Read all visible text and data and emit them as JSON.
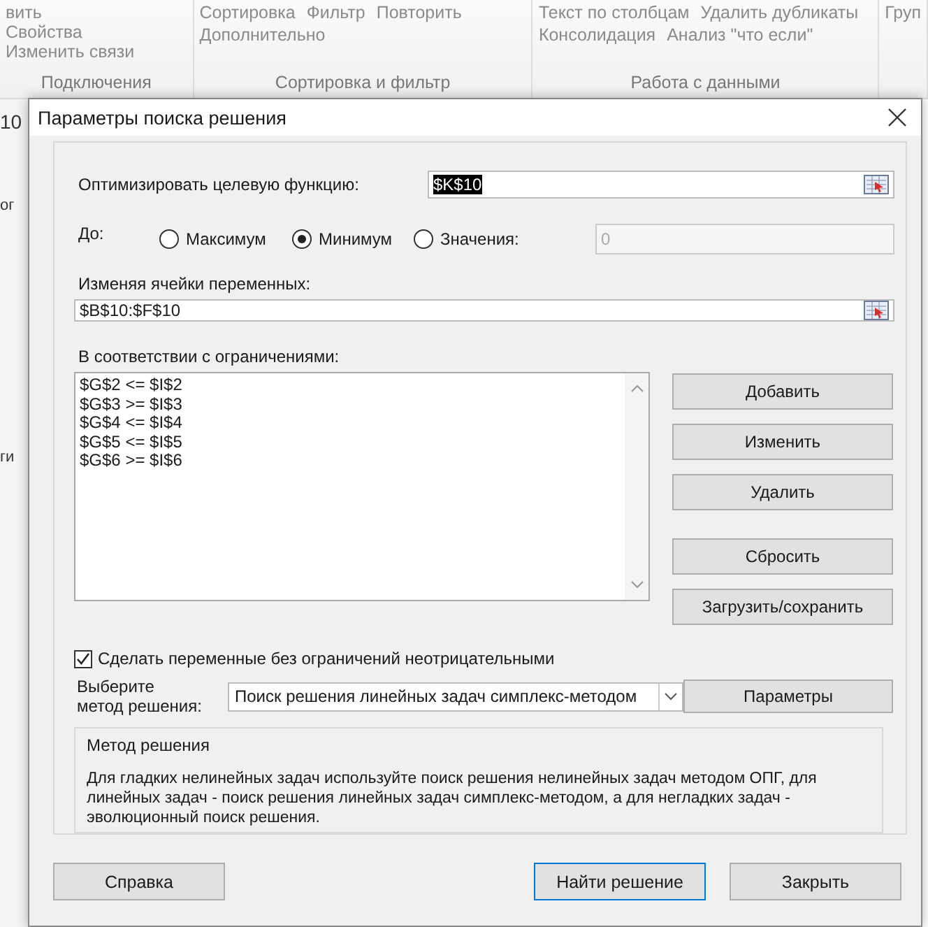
{
  "ribbon": {
    "groups": [
      {
        "label": "Подключения",
        "items": [
          "вить",
          "Свойства",
          "Изменить связи"
        ]
      },
      {
        "label": "Сортировка и фильтр",
        "items": [
          "Сортировка",
          "Фильтр",
          "Повторить",
          "Дополнительно"
        ]
      },
      {
        "label": "Работа с данными",
        "items": [
          "Текст по столбцам",
          "Удалить дубликаты",
          "Консолидация",
          "Анализ \"что если\""
        ]
      },
      {
        "items": [
          "Груп"
        ]
      }
    ]
  },
  "sheet": {
    "cells": [
      "10",
      "ог",
      "ги"
    ]
  },
  "dialog": {
    "title": "Параметры поиска решения",
    "objective": {
      "label": "Оптимизировать целевую функцию:",
      "value": "$K$10"
    },
    "to": {
      "label": "До:",
      "options": [
        {
          "label": "Максимум",
          "selected": false
        },
        {
          "label": "Минимум",
          "selected": true
        },
        {
          "label": "Значения:",
          "selected": false
        }
      ],
      "value": "0",
      "value_disabled": true
    },
    "variables": {
      "label": "Изменяя ячейки переменных:",
      "value": "$B$10:$F$10"
    },
    "constraints": {
      "label": "В соответствии с ограничениями:",
      "items": [
        "$G$2 <= $I$2",
        "$G$3 >= $I$3",
        "$G$4 <= $I$4",
        "$G$5 <= $I$5",
        "$G$6 >= $I$6"
      ]
    },
    "constraint_buttons": [
      "Добавить",
      "Изменить",
      "Удалить",
      "Сбросить",
      "Загрузить/сохранить"
    ],
    "nonnegative": {
      "label": "Сделать переменные без ограничений неотрицательными",
      "checked": true
    },
    "method": {
      "label": "Выберите\nметод решения:",
      "value": "Поиск решения линейных задач симплекс-методом",
      "button": "Параметры"
    },
    "method_info": {
      "title": "Метод решения",
      "text": "Для гладких нелинейных задач используйте поиск решения нелинейных задач методом ОПГ, для линейных задач - поиск решения линейных задач симплекс-методом, а для негладких задач - эволюционный поиск решения."
    },
    "footer_buttons": [
      {
        "label": "Справка",
        "default": false
      },
      {
        "label": "Найти решение",
        "default": true
      },
      {
        "label": "Закрыть",
        "default": false
      }
    ]
  }
}
